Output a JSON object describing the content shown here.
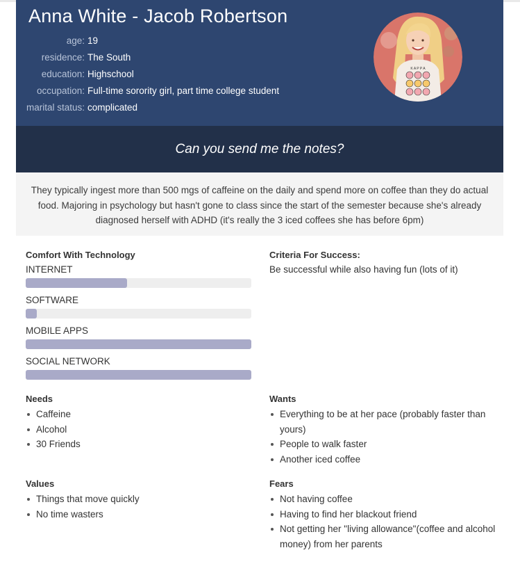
{
  "persona": {
    "name": "Anna White - Jacob Robertson",
    "facts": [
      {
        "label": "age:",
        "value": "19"
      },
      {
        "label": "residence:",
        "value": "The South"
      },
      {
        "label": "education:",
        "value": "Highschool"
      },
      {
        "label": "occupation:",
        "value": "Full-time sorority girl, part time college student"
      },
      {
        "label": "marital status:",
        "value": "complicated"
      }
    ],
    "quote": "Can you send me the notes?",
    "bio": "They typically ingest more than 500 mgs of caffeine on the daily and spend more on coffee than they do actual food. Majoring in psychology but hasn't gone to class since the start of the semester because she's already diagnosed herself with ADHD (it's really the 3 iced coffees she has before 6pm)"
  },
  "tech": {
    "title": "Comfort With Technology",
    "skills": [
      {
        "label": "INTERNET",
        "level": 0.45
      },
      {
        "label": "SOFTWARE",
        "level": 0.05
      },
      {
        "label": "MOBILE APPS",
        "level": 1.0
      },
      {
        "label": "SOCIAL NETWORK",
        "level": 1.0
      }
    ],
    "bar_color": "#a9aac8",
    "track_color": "#eeeeee"
  },
  "criteria": {
    "title": "Criteria For Success:",
    "text": "Be successful while also having fun (lots of it)"
  },
  "needs": {
    "title": "Needs",
    "items": [
      "Caffeine",
      "Alcohol",
      "30 Friends"
    ]
  },
  "wants": {
    "title": "Wants",
    "items": [
      "Everything to be at her pace (probably faster than yours)",
      "People to walk faster",
      "Another iced coffee"
    ]
  },
  "values": {
    "title": "Values",
    "items": [
      "Things that move quickly",
      "No time wasters"
    ]
  },
  "fears": {
    "title": "Fears",
    "items": [
      "Not having coffee",
      "Having to find her blackout friend",
      "Not getting her \"living allowance\"(coffee and alcohol money) from her parents"
    ]
  },
  "colors": {
    "header_bg": "#2e4670",
    "quote_bg": "#223049",
    "bio_bg": "#f4f4f4"
  }
}
